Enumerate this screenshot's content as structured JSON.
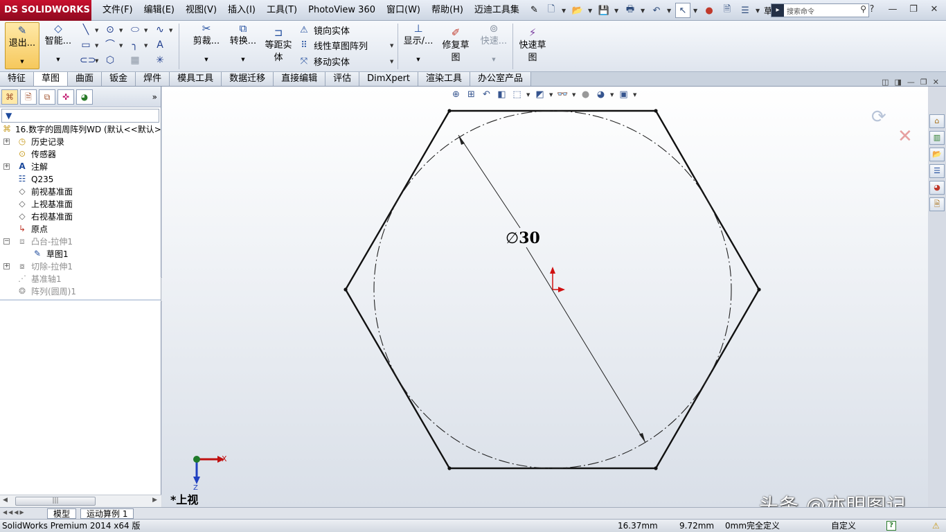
{
  "app": {
    "logo": "SOLIDWORKS",
    "logo_prefix": "DS"
  },
  "menu": [
    "文件(F)",
    "编辑(E)",
    "视图(V)",
    "插入(I)",
    "工具(T)",
    "PhotoView 360",
    "窗口(W)",
    "帮助(H)",
    "迈迪工具集"
  ],
  "search": {
    "placeholder": "搜索命令",
    "trunc_label": "草..."
  },
  "commands": {
    "exit": "退出...",
    "smart": "智能...",
    "trim": "剪裁...",
    "convert": "转换...",
    "offset_line1": "等距实",
    "offset_line2": "体",
    "mirror": "镜向实体",
    "linear_pattern": "线性草图阵列",
    "move": "移动实体",
    "display": "显示/...",
    "repair_line1": "修复草",
    "repair_line2": "图",
    "quick": "快速...",
    "quick_sketch_line1": "快速草",
    "quick_sketch_line2": "图"
  },
  "tabs": [
    "特征",
    "草图",
    "曲面",
    "钣金",
    "焊件",
    "模具工具",
    "数据迁移",
    "直接编辑",
    "评估",
    "DimXpert",
    "渲染工具",
    "办公室产品"
  ],
  "active_tab": "草图",
  "feature_tree": {
    "root": "16.数字的圆周阵列WD  (默认<<默认>",
    "items": [
      {
        "label": "历史记录",
        "icon": "history-icon",
        "expand": "+"
      },
      {
        "label": "传感器",
        "icon": "sensor-icon",
        "expand": ""
      },
      {
        "label": "注解",
        "icon": "annotation-icon",
        "expand": "+"
      },
      {
        "label": "Q235",
        "icon": "material-icon",
        "expand": ""
      },
      {
        "label": "前视基准面",
        "icon": "plane-icon",
        "expand": ""
      },
      {
        "label": "上视基准面",
        "icon": "plane-icon",
        "expand": ""
      },
      {
        "label": "右视基准面",
        "icon": "plane-icon",
        "expand": ""
      },
      {
        "label": "原点",
        "icon": "origin-icon",
        "expand": ""
      },
      {
        "label": "凸台-拉伸1",
        "icon": "extrude-icon",
        "expand": "−",
        "gray": true
      },
      {
        "label": "草图1",
        "icon": "sketch-icon",
        "expand": "",
        "child": true
      },
      {
        "label": "切除-拉伸1",
        "icon": "cut-icon",
        "expand": "+",
        "gray": true
      },
      {
        "label": "基准轴1",
        "icon": "axis-icon",
        "expand": "",
        "gray": true
      },
      {
        "label": "阵列(圆周)1",
        "icon": "pattern-icon",
        "expand": "",
        "gray": true
      }
    ]
  },
  "sketch": {
    "dimension_prefix": "∅",
    "dimension_value": "30",
    "axis_x": "X",
    "axis_z": "Z",
    "view_label": "*上视"
  },
  "watermark": "头条 @亦明图记",
  "bottom_tabs": [
    "模型",
    "运动算例 1"
  ],
  "status": {
    "product": "SolidWorks Premium 2014 x64 版",
    "x": "16.37mm",
    "y": "9.72mm",
    "z": "0mm",
    "state": "完全定义",
    "units": "自定义"
  }
}
